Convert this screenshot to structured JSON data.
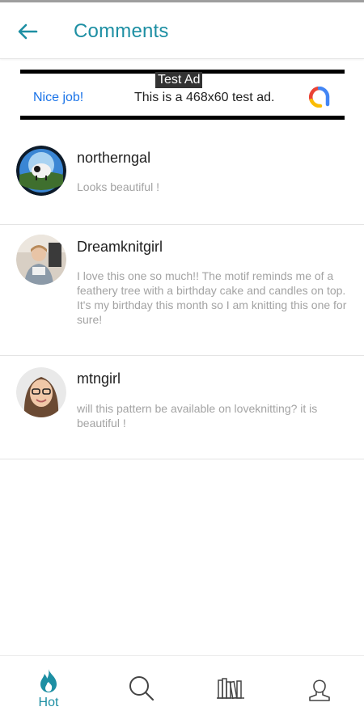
{
  "header": {
    "title": "Comments",
    "back_icon": "arrow-left-icon",
    "accent": "#1d8fa3"
  },
  "ad": {
    "label": "Test Ad",
    "headline": "Nice job!",
    "text": "This is a 468x60 test ad.",
    "logo_icon": "ad-network-logo"
  },
  "comments": [
    {
      "user": "northerngal",
      "text": "Looks beautiful !"
    },
    {
      "user": "Dreamknitgirl",
      "text": "I love this one so much!! The motif reminds me of a feathery tree with a birthday cake and candles on top. It's my birthday this month so I am knitting this one for sure!"
    },
    {
      "user": "mtngirl",
      "text": "will this pattern be available on loveknitting? it is beautiful !"
    }
  ],
  "nav": [
    {
      "label": "Hot",
      "icon": "flame-icon",
      "active": true
    },
    {
      "label": "",
      "icon": "search-icon",
      "active": false
    },
    {
      "label": "",
      "icon": "library-icon",
      "active": false
    },
    {
      "label": "",
      "icon": "profile-icon",
      "active": false
    }
  ]
}
